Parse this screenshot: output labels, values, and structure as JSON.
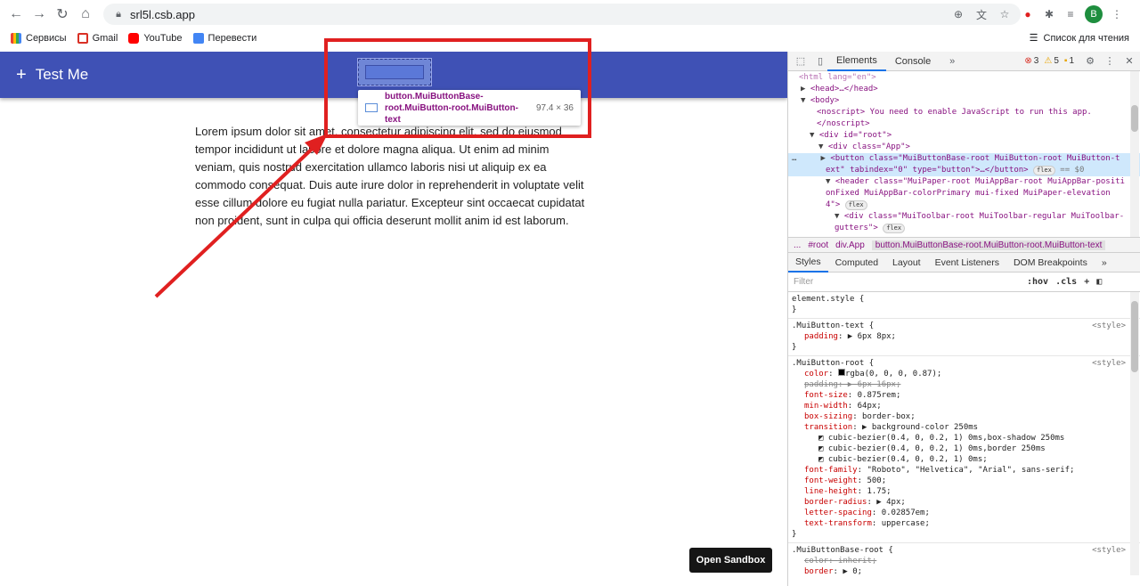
{
  "browser": {
    "url": "srl5l.csb.app",
    "bookmarks": [
      {
        "label": "Сервисы",
        "color": "#ea4335"
      },
      {
        "label": "Gmail",
        "color": "#d93025"
      },
      {
        "label": "YouTube",
        "color": "#ff0000"
      },
      {
        "label": "Перевести",
        "color": "#4285f4"
      }
    ],
    "reading_list": "Список для чтения",
    "avatar_letter": "B"
  },
  "app": {
    "title": "Test Me",
    "plus": "+",
    "tooltip_selector": "button.MuiButtonBase-root.MuiButton-root.MuiButton-text",
    "tooltip_size": "97.4 × 36",
    "lorem": "Lorem ipsum dolor sit amet, consectetur adipiscing elit, sed do eiusmod tempor incididunt ut labore et dolore magna aliqua. Ut enim ad minim veniam, quis nostrud exercitation ullamco laboris nisi ut aliquip ex ea commodo consequat. Duis aute irure dolor in reprehenderit in voluptate velit esse cillum dolore eu fugiat nulla pariatur. Excepteur sint occaecat cupidatat non proident, sunt in culpa qui officia deserunt mollit anim id est laborum.",
    "open_sandbox": "Open Sandbox"
  },
  "devtools": {
    "tabs": [
      "Elements",
      "Console"
    ],
    "errors": "3",
    "warnings": "5",
    "issues": "1",
    "dom": {
      "l0": "<html lang=\"en\">",
      "l1": "<head>…</head>",
      "l2": "<body>",
      "l3": "<noscript> You need to enable JavaScript to run this app.",
      "l4": "</noscript>",
      "l5": "<div id=\"root\">",
      "l6": "<div class=\"App\">",
      "l7a": "<button class=\"MuiButtonBase-root MuiButton-root MuiButton-t",
      "l7b": "ext\" tabindex=\"0\" type=\"button\">…</button>",
      "l7c": "== $0",
      "l8a": "<header class=\"MuiPaper-root MuiAppBar-root MuiAppBar-positi",
      "l8b": "onFixed MuiAppBar-colorPrimary mui-fixed MuiPaper-elevation",
      "l8c": "4\">",
      "l9a": "<div class=\"MuiToolbar-root MuiToolbar-regular MuiToolbar-",
      "l9b": "gutters\">",
      "flex": "flex"
    },
    "breadcrumbs": [
      "...",
      "#root",
      "div.App",
      "button.MuiButtonBase-root.MuiButton-root.MuiButton-text"
    ],
    "style_tabs": [
      "Styles",
      "Computed",
      "Layout",
      "Event Listeners",
      "DOM Breakpoints"
    ],
    "filter_placeholder": "Filter",
    "filter_hov": ":hov",
    "filter_cls": ".cls",
    "rules": {
      "element_style": "element.style {",
      "r1_sel": ".MuiButton-text {",
      "r1_src": "<style>",
      "r1_p1_name": "padding",
      "r1_p1_val": "6px 8px;",
      "r2_sel": ".MuiButton-root {",
      "r2_src": "<style>",
      "r2_color_name": "color",
      "r2_color_val": "rgba(0, 0, 0, 0.87);",
      "r2_pad_name": "padding",
      "r2_pad_val": "6px 16px;",
      "r2_fs_name": "font-size",
      "r2_fs_val": "0.875rem;",
      "r2_mw_name": "min-width",
      "r2_mw_val": "64px;",
      "r2_bs_name": "box-sizing",
      "r2_bs_val": "border-box;",
      "r2_tr_name": "transition",
      "r2_tr_val": "background-color 250ms",
      "r2_tr_1": "cubic-bezier(0.4, 0, 0.2, 1) 0ms,box-shadow 250ms",
      "r2_tr_2": "cubic-bezier(0.4, 0, 0.2, 1) 0ms,border 250ms",
      "r2_tr_3": "cubic-bezier(0.4, 0, 0.2, 1) 0ms;",
      "r2_ff_name": "font-family",
      "r2_ff_val": "\"Roboto\", \"Helvetica\", \"Arial\", sans-serif;",
      "r2_fw_name": "font-weight",
      "r2_fw_val": "500;",
      "r2_lh_name": "line-height",
      "r2_lh_val": "1.75;",
      "r2_br_name": "border-radius",
      "r2_br_val": "4px;",
      "r2_ls_name": "letter-spacing",
      "r2_ls_val": "0.02857em;",
      "r2_tt_name": "text-transform",
      "r2_tt_val": "uppercase;",
      "r3_sel": ".MuiButtonBase-root {",
      "r3_src": "<style>",
      "r3_c_name": "color",
      "r3_c_val": "inherit;",
      "r3_b_name": "border",
      "r3_b_val": "0;"
    }
  },
  "colors": {
    "appbar": "#3f51b5",
    "annotation_red": "#e02020"
  }
}
